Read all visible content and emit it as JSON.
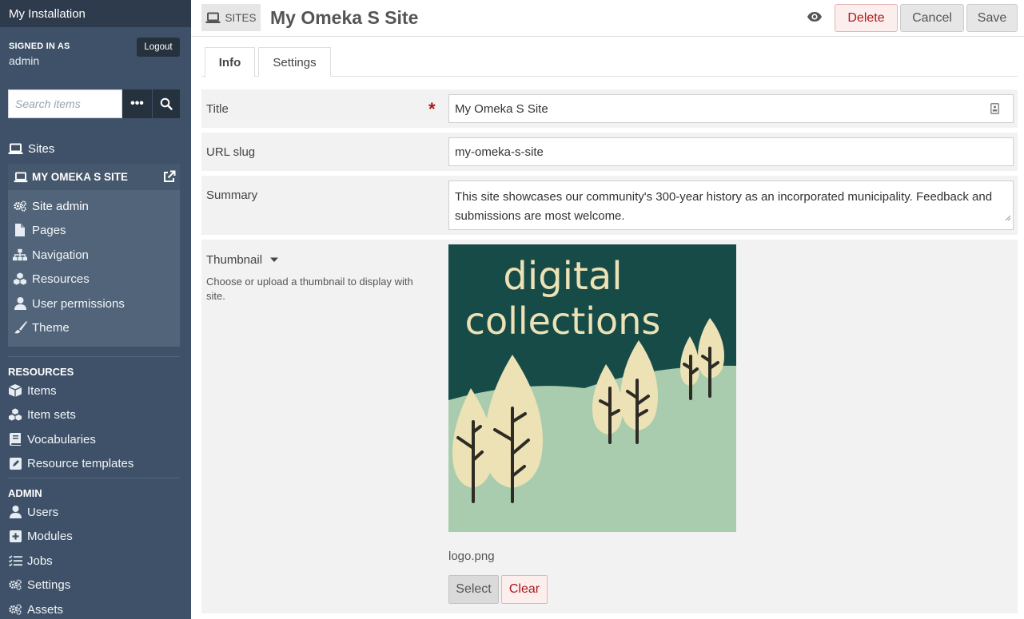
{
  "sidebar": {
    "installation_title": "My Installation",
    "signed_in_label": "SIGNED IN AS",
    "user_name": "admin",
    "logout_label": "Logout",
    "search_placeholder": "Search items",
    "search_more_label": "•••",
    "sites_label": "Sites",
    "current_site": {
      "name": "MY OMEKA S SITE",
      "items": [
        {
          "label": "Site admin",
          "icon": "gears-icon"
        },
        {
          "label": "Pages",
          "icon": "file-icon"
        },
        {
          "label": "Navigation",
          "icon": "sitemap-icon"
        },
        {
          "label": "Resources",
          "icon": "cubes-icon"
        },
        {
          "label": "User permissions",
          "icon": "user-icon"
        },
        {
          "label": "Theme",
          "icon": "paintbrush-icon"
        }
      ]
    },
    "resources_heading": "RESOURCES",
    "resources": [
      {
        "label": "Items",
        "icon": "cube-icon"
      },
      {
        "label": "Item sets",
        "icon": "cubes-icon"
      },
      {
        "label": "Vocabularies",
        "icon": "book-icon"
      },
      {
        "label": "Resource templates",
        "icon": "edit-icon"
      }
    ],
    "admin_heading": "ADMIN",
    "admin": [
      {
        "label": "Users",
        "icon": "user-icon"
      },
      {
        "label": "Modules",
        "icon": "plus-square-icon"
      },
      {
        "label": "Jobs",
        "icon": "list-icon"
      },
      {
        "label": "Settings",
        "icon": "gears-icon"
      },
      {
        "label": "Assets",
        "icon": "gears-icon"
      }
    ]
  },
  "header": {
    "breadcrumb": "SITES",
    "title": "My Omeka S Site",
    "delete_label": "Delete",
    "cancel_label": "Cancel",
    "save_label": "Save"
  },
  "tabs": [
    {
      "label": "Info",
      "active": true
    },
    {
      "label": "Settings",
      "active": false
    }
  ],
  "form": {
    "title_label": "Title",
    "title_value": "My Omeka S Site",
    "slug_label": "URL slug",
    "slug_value": "my-omeka-s-site",
    "summary_label": "Summary",
    "summary_value": "This site showcases our community's 300-year history as an incorporated municipality. Feedback and submissions are most welcome.",
    "thumbnail_label": "Thumbnail",
    "thumbnail_help": "Choose or upload a thumbnail to display with site.",
    "thumbnail_image_text_1": "digital",
    "thumbnail_image_text_2": "collections",
    "thumbnail_filename": "logo.png",
    "select_label": "Select",
    "clear_label": "Clear"
  },
  "colors": {
    "sidebar_bg": "#3f5168",
    "sidebar_dark": "#26313e",
    "danger": "#a91919",
    "thumb_dark": "#174b48",
    "thumb_hill": "#a8ccad",
    "thumb_tree": "#ece2b6"
  }
}
